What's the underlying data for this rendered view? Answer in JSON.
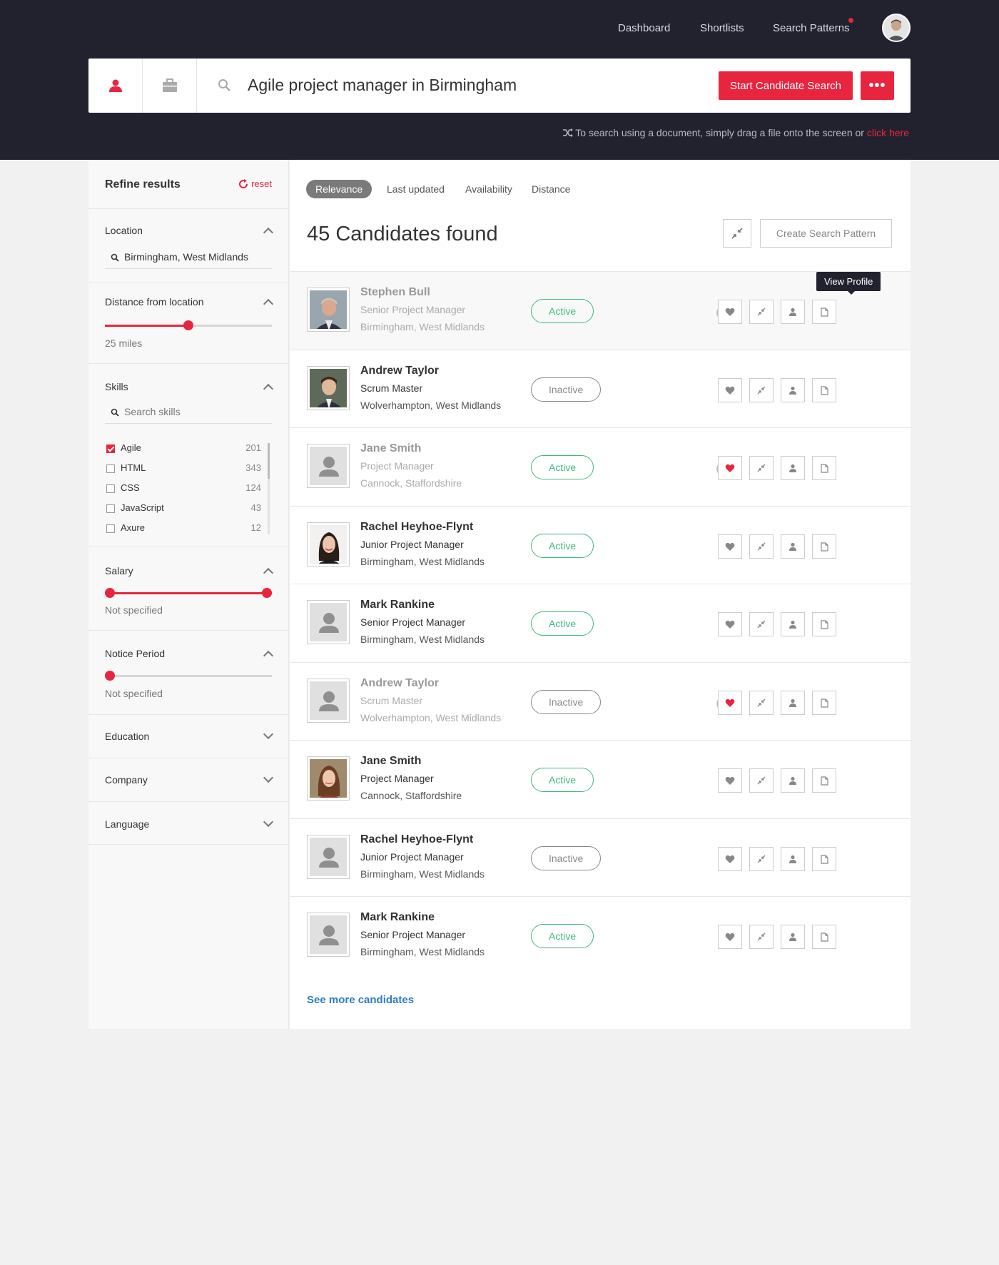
{
  "nav": {
    "items": [
      "Dashboard",
      "Shortlists",
      "Search Patterns"
    ]
  },
  "search": {
    "query": "Agile project manager in Birmingham",
    "start_button": "Start Candidate Search",
    "more_button": "•••",
    "hint_text": "To search using a document, simply drag a file onto the screen or ",
    "hint_link": "click here"
  },
  "sidebar": {
    "title": "Refine results",
    "reset": "reset",
    "location": {
      "label": "Location",
      "value": "Birmingham, West Midlands"
    },
    "distance": {
      "label": "Distance from location",
      "value_text": "25 miles",
      "level_fraction": 0.5
    },
    "skills": {
      "label": "Skills",
      "placeholder": "Search skills",
      "items": [
        {
          "name": "Agile",
          "count": "201",
          "checked": true
        },
        {
          "name": "HTML",
          "count": "343",
          "checked": false
        },
        {
          "name": "CSS",
          "count": "124",
          "checked": false
        },
        {
          "name": "JavaScript",
          "count": "43",
          "checked": false
        },
        {
          "name": "Axure",
          "count": "12",
          "checked": false
        }
      ]
    },
    "salary": {
      "label": "Salary",
      "value_text": "Not specified",
      "range": [
        0,
        1
      ]
    },
    "notice": {
      "label": "Notice Period",
      "value_text": "Not specified",
      "level_fraction": 0
    },
    "collapsed": [
      "Education",
      "Company",
      "Language"
    ]
  },
  "main": {
    "sort_tabs": [
      "Relevance",
      "Last updated",
      "Availability",
      "Distance"
    ],
    "active_sort": "Relevance",
    "result_count": "45 Candidates found",
    "create_pattern": "Create Search Pattern",
    "tooltip": "View Profile",
    "see_more": "See more candidates",
    "candidates": [
      {
        "name": "Stephen Bull",
        "role": "Senior Project Manager",
        "location": "Birmingham, West Midlands",
        "status": "Active",
        "muted": true,
        "checked": true,
        "favorite": false,
        "photo": "man-grey-hair"
      },
      {
        "name": "Andrew Taylor",
        "role": "Scrum Master",
        "location": "Wolverhampton, West Midlands",
        "status": "Inactive",
        "muted": false,
        "checked": false,
        "favorite": false,
        "photo": "man-dark-hair"
      },
      {
        "name": "Jane Smith",
        "role": "Project Manager",
        "location": "Cannock, Staffordshire",
        "status": "Active",
        "muted": true,
        "checked": true,
        "favorite": true,
        "photo": "placeholder"
      },
      {
        "name": "Rachel Heyhoe-Flynt",
        "role": "Junior Project Manager",
        "location": "Birmingham, West Midlands",
        "status": "Active",
        "muted": false,
        "checked": false,
        "favorite": false,
        "photo": "woman-dark-hair"
      },
      {
        "name": "Mark Rankine",
        "role": "Senior Project Manager",
        "location": "Birmingham, West Midlands",
        "status": "Active",
        "muted": false,
        "checked": false,
        "favorite": false,
        "photo": "placeholder"
      },
      {
        "name": "Andrew Taylor",
        "role": "Scrum Master",
        "location": "Wolverhampton, West Midlands",
        "status": "Inactive",
        "muted": true,
        "checked": true,
        "favorite": true,
        "photo": "placeholder"
      },
      {
        "name": "Jane Smith",
        "role": "Project Manager",
        "location": "Cannock, Staffordshire",
        "status": "Active",
        "muted": false,
        "checked": false,
        "favorite": false,
        "photo": "woman-brown-hair"
      },
      {
        "name": "Rachel Heyhoe-Flynt",
        "role": "Junior Project Manager",
        "location": "Birmingham, West Midlands",
        "status": "Inactive",
        "muted": false,
        "checked": false,
        "favorite": false,
        "photo": "placeholder"
      },
      {
        "name": "Mark Rankine",
        "role": "Senior Project Manager",
        "location": "Birmingham, West Midlands",
        "status": "Active",
        "muted": false,
        "checked": false,
        "favorite": false,
        "photo": "placeholder"
      }
    ]
  },
  "colors": {
    "accent": "#e8253f",
    "header_bg": "#22222f",
    "active": "#3fb87a",
    "link": "#2f7dc4"
  }
}
